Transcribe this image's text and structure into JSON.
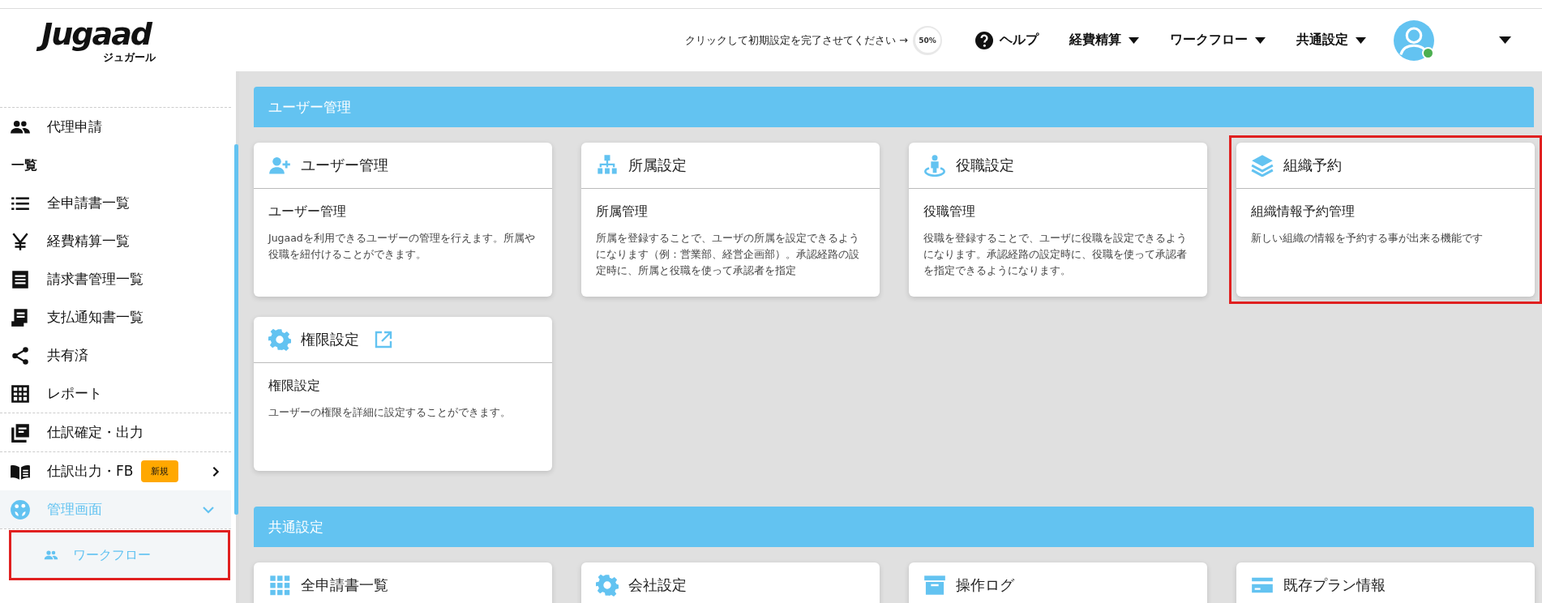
{
  "logo": {
    "name": "Jugaad",
    "reading": "ジュガール"
  },
  "header": {
    "setup": {
      "prompt": "クリックして初期設定を完了させてください →",
      "progress": "50%"
    },
    "help": "ヘルプ",
    "menus": [
      "経費精算",
      "ワークフロー",
      "共通設定"
    ],
    "user": {
      "online": true
    }
  },
  "sidebar": {
    "items": [
      {
        "kind": "people",
        "label": "代理申請",
        "divider": true
      },
      {
        "kind": "heading",
        "label": "一覧"
      },
      {
        "kind": "list",
        "label": "全申請書一覧"
      },
      {
        "kind": "yen",
        "label": "経費精算一覧"
      },
      {
        "kind": "receipt",
        "label": "請求書管理一覧"
      },
      {
        "kind": "document",
        "label": "支払通知書一覧"
      },
      {
        "kind": "share",
        "label": "共有済"
      },
      {
        "kind": "grid",
        "label": "レポート"
      },
      {
        "kind": "book-list",
        "label": "仕訳確定・出力",
        "divider": true
      },
      {
        "kind": "book",
        "label": "仕訳出力・FB",
        "badge": "新規",
        "chevron": true,
        "divider": true
      },
      {
        "kind": "palette",
        "label": "管理画面",
        "expanded": true,
        "children": [
          {
            "kind": "people",
            "label": "ワークフロー",
            "highlighted": true
          }
        ]
      }
    ]
  },
  "sections": [
    {
      "title": "ユーザー管理",
      "cards": [
        {
          "kind": "user-plus",
          "title": "ユーザー管理",
          "subtitle": "ユーザー管理",
          "description": "Jugaadを利用できるユーザーの管理を行えます。所属や役職を紐付けることができます。",
          "external_link": false,
          "highlighted": false
        },
        {
          "kind": "sitemap",
          "title": "所属設定",
          "subtitle": "所属管理",
          "description": "所属を登録することで、ユーザの所属を設定できるようになります（例：営業部、経営企画部）。承認経路の設定時に、所属と役職を使って承認者を指定",
          "external_link": false,
          "highlighted": false
        },
        {
          "kind": "person-pin",
          "title": "役職設定",
          "subtitle": "役職管理",
          "description": "役職を登録することで、ユーザに役職を設定できるようになります。承認経路の設定時に、役職を使って承認者を指定できるようになります。",
          "external_link": false,
          "highlighted": false
        },
        {
          "kind": "layers",
          "title": "組織予約",
          "subtitle": "組織情報予約管理",
          "description": "新しい組織の情報を予約する事が出来る機能です",
          "external_link": false,
          "highlighted": true
        },
        {
          "kind": "gear",
          "title": "権限設定",
          "subtitle": "権限設定",
          "description": "ユーザーの権限を詳細に設定することができます。",
          "external_link": true,
          "highlighted": false
        }
      ]
    },
    {
      "title": "共通設定",
      "cards": [
        {
          "kind": "grid",
          "title": "全申請書一覧",
          "external_link": false,
          "highlighted": false
        },
        {
          "kind": "gear",
          "title": "会社設定",
          "external_link": false,
          "highlighted": false
        },
        {
          "kind": "archive",
          "title": "操作ログ",
          "external_link": false,
          "highlighted": false
        },
        {
          "kind": "card",
          "title": "既存プラン情報",
          "external_link": false,
          "highlighted": false
        }
      ]
    }
  ]
}
